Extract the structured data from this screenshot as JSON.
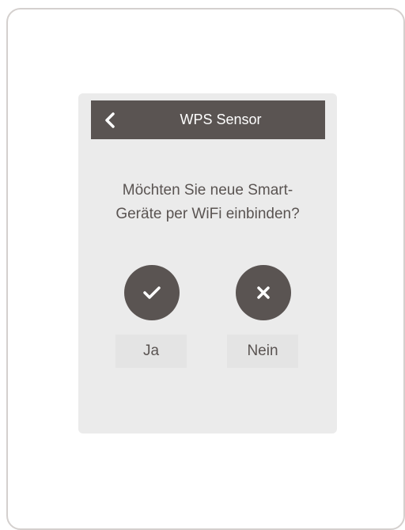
{
  "header": {
    "title": "WPS Sensor",
    "back_icon": "chevron-left-icon"
  },
  "dialog": {
    "question_line1": "Möchten Sie neue Smart-",
    "question_line2": "Geräte per WiFi einbinden?"
  },
  "actions": {
    "yes_label": "Ja",
    "yes_icon": "checkmark-icon",
    "no_label": "Nein",
    "no_icon": "close-icon"
  },
  "colors": {
    "dark": "#5a5452",
    "screen_bg": "#ebebeb",
    "label_bg": "#e4e4e4",
    "frame_border": "#d4d0ce"
  }
}
